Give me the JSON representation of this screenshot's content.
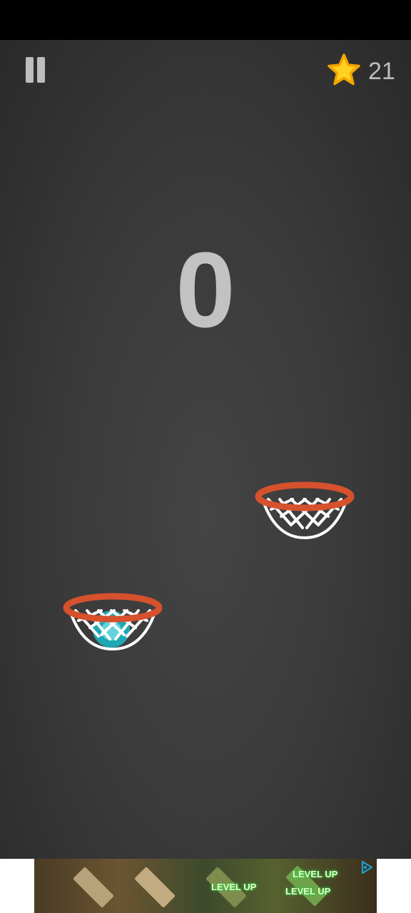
{
  "hud": {
    "star_count": "21",
    "score": "0"
  },
  "ad": {
    "labels": [
      "LEVEL UP",
      "LEVEL UP",
      "LEVEL UP"
    ]
  },
  "colors": {
    "rim": "#d6512d",
    "net": "#ffffff",
    "ball": "#1fa8b3",
    "star_fill": "#ffd21f",
    "star_stroke": "#f5a300",
    "hud_text": "#bdbdbd"
  },
  "icons": {
    "pause": "pause-icon",
    "star": "star-icon",
    "ad_choices": "ad-choices-icon"
  }
}
